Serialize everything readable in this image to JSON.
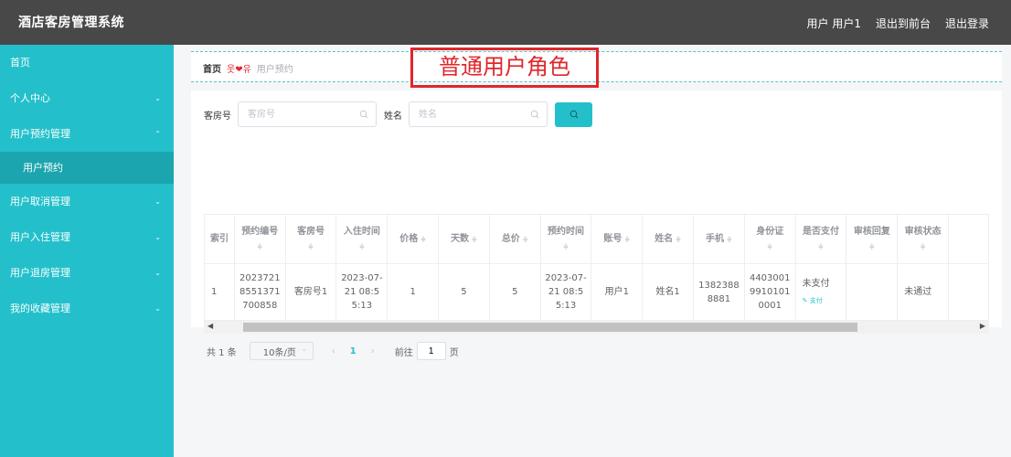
{
  "app": {
    "title": "酒店客房管理系统"
  },
  "topbar": {
    "user_label": "用户 用户1",
    "back_to_front": "退出到前台",
    "logout": "退出登录"
  },
  "sidebar": {
    "items": [
      {
        "label": "首页",
        "has_chevron": false
      },
      {
        "label": "个人中心",
        "chevron": "⌄"
      },
      {
        "label": "用户预约管理",
        "chevron": "⌃",
        "expanded": true,
        "children": [
          {
            "label": "用户预约",
            "active": true
          }
        ]
      },
      {
        "label": "用户取消管理",
        "chevron": "⌄"
      },
      {
        "label": "用户入住管理",
        "chevron": "⌄"
      },
      {
        "label": "用户退房管理",
        "chevron": "⌄"
      },
      {
        "label": "我的收藏管理",
        "chevron": "⌄"
      }
    ]
  },
  "breadcrumb": {
    "home": "首页",
    "separator": "웃❤유",
    "current": "用户预约"
  },
  "annotation": {
    "text": "普通用户角色",
    "color": "#e0262c"
  },
  "search": {
    "room_label": "客房号",
    "room_placeholder": "客房号",
    "name_label": "姓名",
    "name_placeholder": "姓名"
  },
  "table": {
    "columns": [
      "索引",
      "预约编号",
      "客房号",
      "入住时间",
      "价格",
      "天数",
      "总价",
      "预约时间",
      "账号",
      "姓名",
      "手机",
      "身份证",
      "是否支付",
      "审核回复",
      "审核状态",
      ""
    ],
    "sort_icon": "≑",
    "rows": [
      {
        "index": "1",
        "booking_no": "20237218551371700858",
        "room_no": "客房号1",
        "checkin_time": "2023-07-21 08:55:13",
        "price": "1",
        "days": "5",
        "total": "5",
        "booking_time": "2023-07-21 08:55:13",
        "account": "用户1",
        "name": "姓名1",
        "phone": "13823888881",
        "id_card": "440300199101010001",
        "paid": "未支付",
        "pay_action": "支付",
        "review_reply": "",
        "review_status": "未通过"
      }
    ]
  },
  "pagination": {
    "total": "共 1 条",
    "page_size": "10条/页",
    "current_page": "1",
    "goto_label": "前往",
    "goto_value": "1",
    "page_suffix": "页"
  },
  "colors": {
    "accent": "#23c0cb",
    "topbar": "#484848",
    "sidebar_active": "#1ba5ae"
  }
}
